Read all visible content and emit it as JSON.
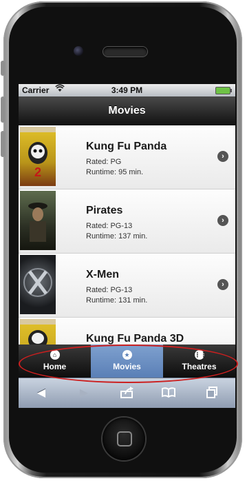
{
  "status_bar": {
    "carrier": "Carrier",
    "time": "3:49 PM"
  },
  "nav": {
    "title": "Movies"
  },
  "movies": [
    {
      "title": "Kung Fu Panda",
      "rated": "Rated: PG",
      "runtime": "Runtime: 95 min."
    },
    {
      "title": "Pirates",
      "rated": "Rated: PG-13",
      "runtime": "Runtime: 137 min."
    },
    {
      "title": "X-Men",
      "rated": "Rated: PG-13",
      "runtime": "Runtime: 131 min."
    },
    {
      "title": "Kung Fu Panda 3D"
    }
  ],
  "tabs": [
    {
      "label": "Home",
      "icon": "home-icon"
    },
    {
      "label": "Movies",
      "icon": "star-icon"
    },
    {
      "label": "Theatres",
      "icon": "grid-icon"
    }
  ],
  "colors": {
    "active_tab": "#6b8fc4",
    "highlight": "#cc1f1f",
    "battery": "#6ec246"
  }
}
